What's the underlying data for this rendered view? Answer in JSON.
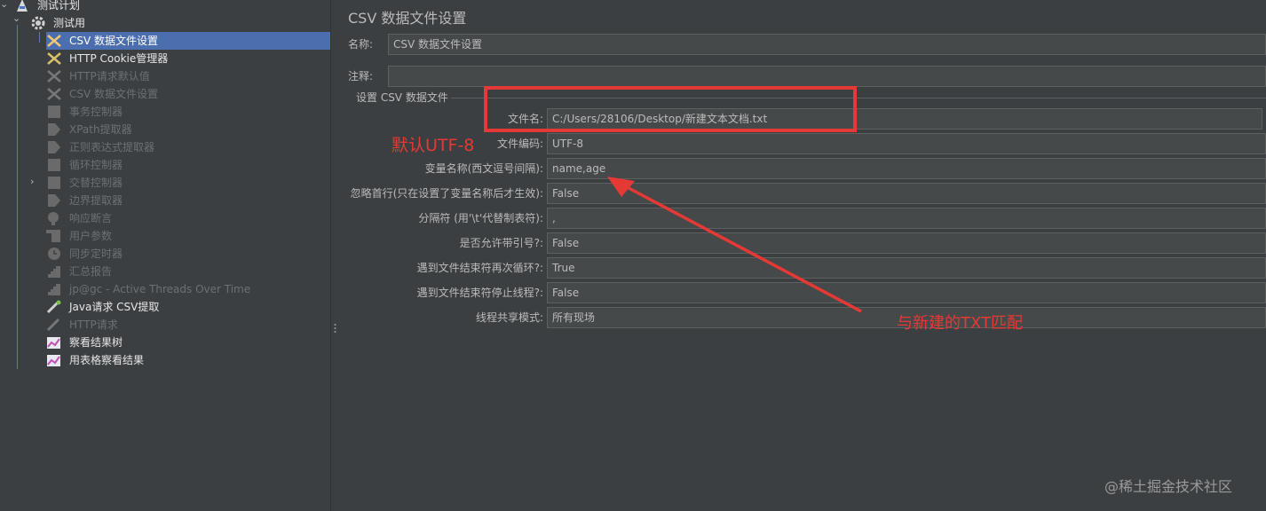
{
  "tree": {
    "items": [
      {
        "label": "测试计划",
        "icon": "test-plan-icon",
        "state": "enabled"
      },
      {
        "label": "测试用",
        "icon": "thread-group-gear-icon",
        "state": "enabled"
      },
      {
        "label": "CSV 数据文件设置",
        "icon": "config-scissors-icon",
        "state": "selected"
      },
      {
        "label": "HTTP Cookie管理器",
        "icon": "config-scissors-icon",
        "state": "enabled"
      },
      {
        "label": "HTTP请求默认值",
        "icon": "config-scissors-icon",
        "state": "disabled"
      },
      {
        "label": "CSV 数据文件设置",
        "icon": "config-scissors-icon",
        "state": "disabled"
      },
      {
        "label": "事务控制器",
        "icon": "controller-icon",
        "state": "disabled"
      },
      {
        "label": "XPath提取器",
        "icon": "extractor-icon",
        "state": "disabled"
      },
      {
        "label": "正则表达式提取器",
        "icon": "extractor-icon",
        "state": "disabled"
      },
      {
        "label": "循环控制器",
        "icon": "controller-icon",
        "state": "disabled"
      },
      {
        "label": "交替控制器",
        "icon": "controller-icon",
        "state": "disabled"
      },
      {
        "label": "边界提取器",
        "icon": "extractor-icon",
        "state": "disabled"
      },
      {
        "label": "响应断言",
        "icon": "assertion-icon",
        "state": "disabled"
      },
      {
        "label": "用户参数",
        "icon": "preprocessor-icon",
        "state": "disabled"
      },
      {
        "label": "同步定时器",
        "icon": "timer-icon",
        "state": "disabled"
      },
      {
        "label": "汇总报告",
        "icon": "report-chart-icon",
        "state": "disabled"
      },
      {
        "label": "jp@gc - Active Threads Over Time",
        "icon": "report-chart-icon",
        "state": "disabled"
      },
      {
        "label": "Java请求 CSV提取",
        "icon": "java-sampler-icon",
        "state": "enabled"
      },
      {
        "label": "HTTP请求",
        "icon": "sampler-pipette-icon",
        "state": "disabled"
      },
      {
        "label": "察看结果树",
        "icon": "listener-chart-icon",
        "state": "enabled"
      },
      {
        "label": "用表格察看结果",
        "icon": "listener-chart-icon",
        "state": "enabled"
      }
    ]
  },
  "panel": {
    "title": "CSV 数据文件设置",
    "name_label": "名称:",
    "name_value": "CSV 数据文件设置",
    "comment_label": "注释:",
    "comment_value": "",
    "section_title": "设置 CSV 数据文件",
    "fields": [
      {
        "label": "文件名:",
        "value": "C:/Users/28106/Desktop/新建文本文档.txt"
      },
      {
        "label": "文件编码:",
        "value": "UTF-8"
      },
      {
        "label": "变量名称(西文逗号间隔):",
        "value": "name,age"
      },
      {
        "label": "忽略首行(只在设置了变量名称后才生效):",
        "value": "False"
      },
      {
        "label": "分隔符 (用'\\t'代替制表符):",
        "value": ","
      },
      {
        "label": "是否允许带引号?:",
        "value": "False"
      },
      {
        "label": "遇到文件结束符再次循环?:",
        "value": "True"
      },
      {
        "label": "遇到文件结束符停止线程?:",
        "value": "False"
      },
      {
        "label": "线程共享模式:",
        "value": "所有现场"
      }
    ]
  },
  "annotations": {
    "default_utf8_note": "默认UTF-8",
    "txt_match_note": "与新建的TXT匹配",
    "color": "#e53935"
  },
  "watermark": "@稀土掘金技术社区",
  "colors": {
    "background": "#3c3f41",
    "selection": "#4b6eaf",
    "field_background": "#45494a",
    "annotation_red": "#e53935"
  }
}
